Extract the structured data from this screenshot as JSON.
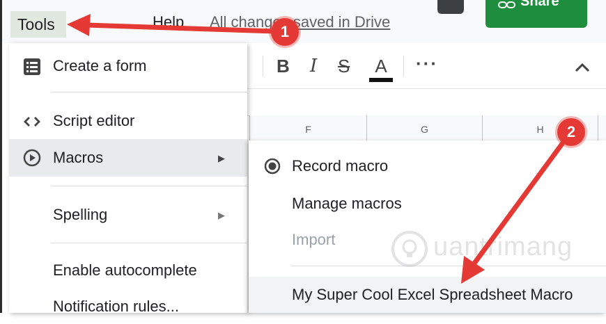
{
  "menubar": {
    "tools_label": "Tools",
    "help_label": "Help",
    "saved_status": "All changes saved in Drive",
    "share_label": "Share"
  },
  "toolbar": {
    "bold": "B",
    "italic": "I",
    "strikethrough": "S",
    "text_color": "A",
    "more": "···"
  },
  "columns": [
    "F",
    "G",
    "H"
  ],
  "tools_menu": {
    "items": [
      {
        "label": "Create a form",
        "icon": "form-icon"
      },
      {
        "label": "Script editor",
        "icon": "code-icon"
      },
      {
        "label": "Macros",
        "icon": "macro-play-icon",
        "submenu": true
      },
      {
        "label": "Spelling",
        "submenu": true
      },
      {
        "label": "Enable autocomplete"
      },
      {
        "label": "Notification rules..."
      }
    ]
  },
  "macros_menu": {
    "items": [
      {
        "label": "Record macro",
        "icon": "radio-record-icon"
      },
      {
        "label": "Manage macros"
      },
      {
        "label": "Import",
        "disabled": true
      },
      {
        "label": "My Super Cool Excel Spreadsheet Macro"
      }
    ]
  },
  "annotations": {
    "callout_1": "1",
    "callout_2": "2"
  },
  "watermark": {
    "text": "uantrimang"
  },
  "colors": {
    "share_green": "#1e8e3e",
    "callout_red": "#e53935",
    "menu_highlight": "#e8eaed",
    "disabled_text": "#9aa0a6"
  }
}
